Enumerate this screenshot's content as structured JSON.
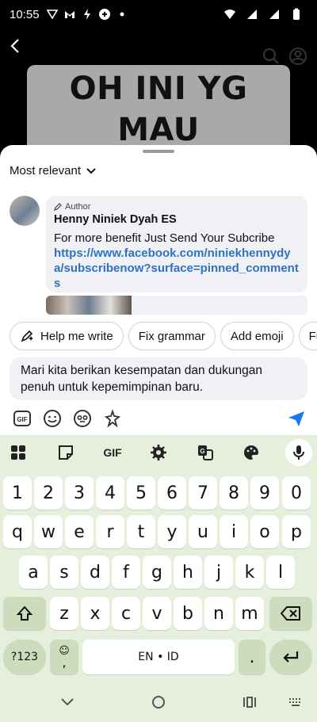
{
  "status_bar": {
    "time": "10:55"
  },
  "video": {
    "caption": "OH INI YG MAU JATUHKAN"
  },
  "comments": {
    "sort_label": "Most relevant",
    "author_tag": "Author",
    "author_name": "Henny Niniek Dyah ES",
    "text": "For more benefit Just Send Your Subcribe",
    "link": "https://www.facebook.com/niniekhennydya/subscribenow?surface=pinned_comments"
  },
  "suggestions": [
    "Help me write",
    "Fix grammar",
    "Add emoji",
    "Fu"
  ],
  "composer": {
    "text": "Mari kita berikan kesempatan dan dukungan penuh untuk kepemimpinan baru."
  },
  "keyboard": {
    "gif_label": "GIF",
    "row1": [
      "1",
      "2",
      "3",
      "4",
      "5",
      "6",
      "7",
      "8",
      "9",
      "0"
    ],
    "row2": [
      "q",
      "w",
      "e",
      "r",
      "t",
      "y",
      "u",
      "i",
      "o",
      "p"
    ],
    "row3": [
      "a",
      "s",
      "d",
      "f",
      "g",
      "h",
      "j",
      "k",
      "l"
    ],
    "row4": [
      "z",
      "x",
      "c",
      "v",
      "b",
      "n",
      "m"
    ],
    "symbols_label": "?123",
    "comma": ",",
    "space_label": "EN • ID",
    "period": "."
  },
  "colors": {
    "accent_blue": "#2f72c4",
    "keyboard_bg": "#e6eedc",
    "send_blue": "#1877f2"
  }
}
